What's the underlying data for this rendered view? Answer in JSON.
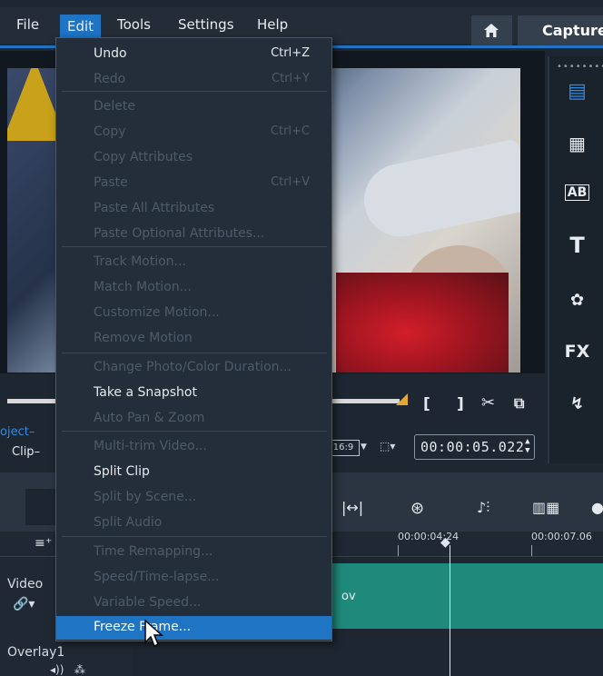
{
  "menubar": {
    "items": [
      "File",
      "Edit",
      "Tools",
      "Settings",
      "Help"
    ],
    "active": "Edit",
    "capture_tab": "Capture"
  },
  "edit_menu": {
    "items": [
      {
        "label": "Undo",
        "shortcut": "Ctrl+Z",
        "enabled": true
      },
      {
        "label": "Redo",
        "shortcut": "Ctrl+Y",
        "enabled": false
      },
      {
        "label": "Delete",
        "shortcut": "",
        "enabled": false
      },
      {
        "label": "Copy",
        "shortcut": "Ctrl+C",
        "enabled": false
      },
      {
        "label": "Copy Attributes",
        "shortcut": "",
        "enabled": false
      },
      {
        "label": "Paste",
        "shortcut": "Ctrl+V",
        "enabled": false
      },
      {
        "label": "Paste All Attributes",
        "shortcut": "",
        "enabled": false
      },
      {
        "label": "Paste Optional Attributes...",
        "shortcut": "",
        "enabled": false
      },
      {
        "label": "Track Motion...",
        "shortcut": "",
        "enabled": false
      },
      {
        "label": "Match Motion...",
        "shortcut": "",
        "enabled": false
      },
      {
        "label": "Customize Motion...",
        "shortcut": "",
        "enabled": false
      },
      {
        "label": "Remove Motion",
        "shortcut": "",
        "enabled": false
      },
      {
        "label": "Change Photo/Color Duration...",
        "shortcut": "",
        "enabled": false
      },
      {
        "label": "Take a Snapshot",
        "shortcut": "",
        "enabled": true
      },
      {
        "label": "Auto Pan & Zoom",
        "shortcut": "",
        "enabled": false
      },
      {
        "label": "Multi-trim Video...",
        "shortcut": "",
        "enabled": false
      },
      {
        "label": "Split Clip",
        "shortcut": "",
        "enabled": true
      },
      {
        "label": "Split by Scene...",
        "shortcut": "",
        "enabled": false
      },
      {
        "label": "Split Audio",
        "shortcut": "",
        "enabled": false
      },
      {
        "label": "Time Remapping...",
        "shortcut": "",
        "enabled": false
      },
      {
        "label": "Speed/Time-lapse...",
        "shortcut": "",
        "enabled": false
      },
      {
        "label": "Variable Speed...",
        "shortcut": "",
        "enabled": false
      },
      {
        "label": "Freeze Frame...",
        "shortcut": "",
        "enabled": true,
        "highlighted": true
      }
    ]
  },
  "preview": {
    "tab_project": "oject",
    "tab_clip": "Clip",
    "aspect": "16:9",
    "timecode": "00:00:05.022"
  },
  "timeline": {
    "ruler_labels": [
      "00:00:04:24",
      "00:00:07.06"
    ],
    "tracks": [
      {
        "name": "Video",
        "clip_text": "ov"
      },
      {
        "name": "Overlay1"
      }
    ]
  },
  "sidebar": {
    "icons": [
      "media-icon",
      "instant-project-icon",
      "transition-icon",
      "title-icon",
      "graphics-icon",
      "fx-icon",
      "path-icon"
    ],
    "fx_label": "FX"
  },
  "colors": {
    "accent": "#1f74c4",
    "clip": "#1f8a7b",
    "progress_marker": "#e4a934"
  }
}
